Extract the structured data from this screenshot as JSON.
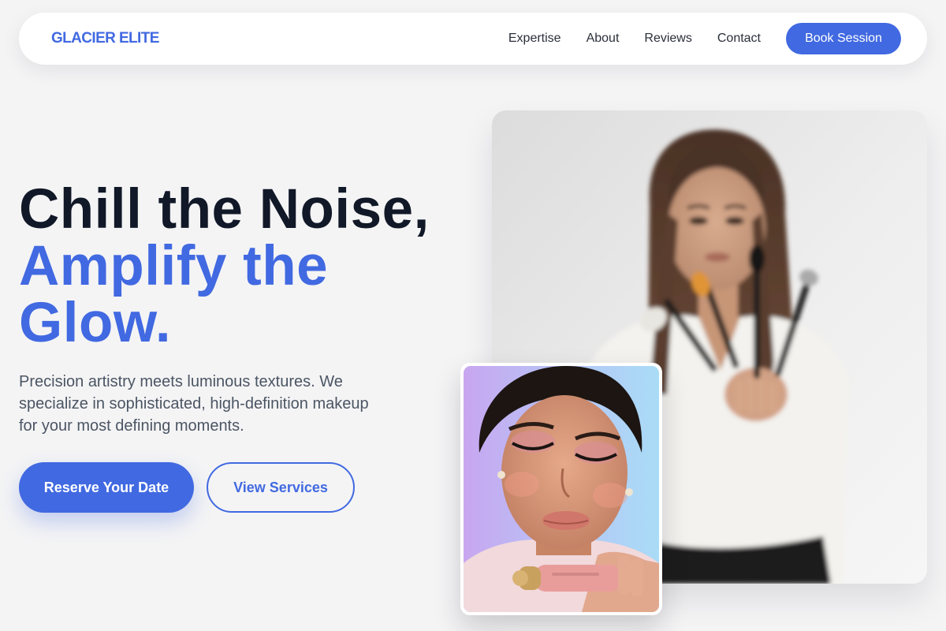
{
  "nav": {
    "brand": "GLACIER ELITE",
    "links": [
      "Expertise",
      "About",
      "Reviews",
      "Contact"
    ],
    "cta": "Book Session"
  },
  "hero": {
    "title_line1": "Chill the Noise,",
    "title_line2": "Amplify the Glow.",
    "description": "Precision artistry meets luminous textures. We specialize in sophisticated, high-definition makeup for your most defining moments.",
    "primary_button": "Reserve Your Date",
    "secondary_button": "View Services"
  },
  "colors": {
    "accent": "#4169e1",
    "heading": "#111827",
    "body_text": "#4b5563",
    "background": "#f4f4f5"
  },
  "images": {
    "main_photo_icon": "makeup-artist-photo",
    "inset_photo_icon": "model-portrait-photo"
  }
}
